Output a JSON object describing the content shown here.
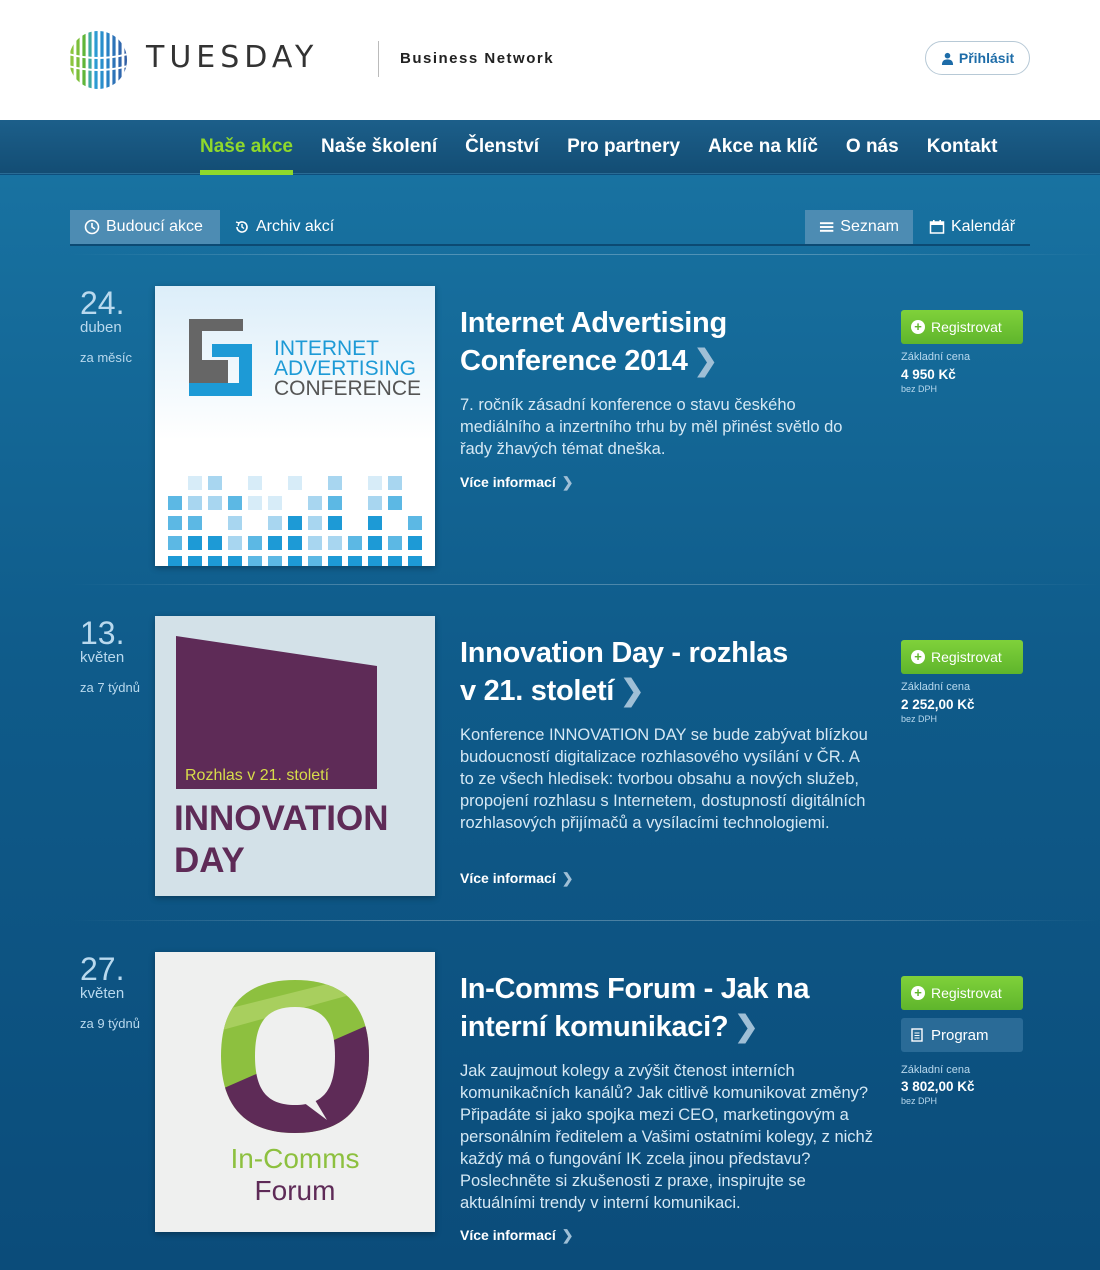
{
  "header": {
    "brand": "TUESDAY",
    "tagline": "Business Network",
    "login_label": "Přihlásit"
  },
  "nav": {
    "items": [
      {
        "label": "Naše akce",
        "active": true
      },
      {
        "label": "Naše školení",
        "active": false
      },
      {
        "label": "Členství",
        "active": false
      },
      {
        "label": "Pro partnery",
        "active": false
      },
      {
        "label": "Akce na klíč",
        "active": false
      },
      {
        "label": "O nás",
        "active": false
      },
      {
        "label": "Kontakt",
        "active": false
      }
    ]
  },
  "subnav": {
    "upcoming_label": "Budoucí akce",
    "archive_label": "Archiv akcí",
    "list_label": "Seznam",
    "calendar_label": "Kalendář"
  },
  "events": [
    {
      "day": "24.",
      "month": "duben",
      "relative": "za měsíc",
      "title_line1": "Internet Advertising",
      "title_line2": "Conference 2014",
      "description": "7. ročník zásadní konference o stavu českého mediálního a inzertního trhu by měl přinést světlo do řady žhavých témat dneška.",
      "more_label": "Více informací",
      "register_label": "Registrovat",
      "price_label": "Základní cena",
      "price": "4 950 Kč",
      "price_note": "bez DPH",
      "logo_lines": [
        "INTERNET",
        "ADVERTISING",
        "CONFERENCE"
      ]
    },
    {
      "day": "13.",
      "month": "květen",
      "relative": "za 7 týdnů",
      "title_line1": "Innovation Day - rozhlas",
      "title_line2": "v 21. století",
      "description": "Konference INNOVATION DAY se bude zabývat blízkou budoucností digitalizace rozhlasového vysílání v ČR. A to ze všech hledisek: tvorbou obsahu a nových služeb, propojení rozhlasu s Internetem, dostupností digitálních rozhlasových přijímačů a vysílacími technologiemi.",
      "more_label": "Více informací",
      "register_label": "Registrovat",
      "price_label": "Základní cena",
      "price": "2 252,00 Kč",
      "price_note": "bez DPH",
      "logo_sub": "Rozhlas v 21. století",
      "logo_line1": "INNOVATION",
      "logo_line2": "DAY"
    },
    {
      "day": "27.",
      "month": "květen",
      "relative": "za 9 týdnů",
      "title_line1": "In-Comms Forum - Jak na",
      "title_line2": "interní komunikaci?",
      "description": "Jak zaujmout kolegy a zvýšit čtenost interních komunikačních kanálů? Jak citlivě komunikovat změny? Připadáte si jako spojka mezi CEO, marketingovým a personálním ředitelem a Vašimi ostatními kolegy, z nichž každý má o fungování IK zcela jinou představu? Poslechněte si zkušenosti z praxe, inspirujte se aktuálními trendy v interní komunikaci.",
      "more_label": "Více informací",
      "register_label": "Registrovat",
      "program_label": "Program",
      "price_label": "Základní cena",
      "price": "3 802,00 Kč",
      "price_note": "bez DPH",
      "logo_line1": "In-Comms",
      "logo_line2": "Forum"
    }
  ],
  "colors": {
    "accent_green": "#8fd82b",
    "button_green": "#6cc233",
    "page_blue": "#0e4f7d",
    "innovation_purple": "#5e2b57",
    "incomms_green": "#8dc03f"
  }
}
